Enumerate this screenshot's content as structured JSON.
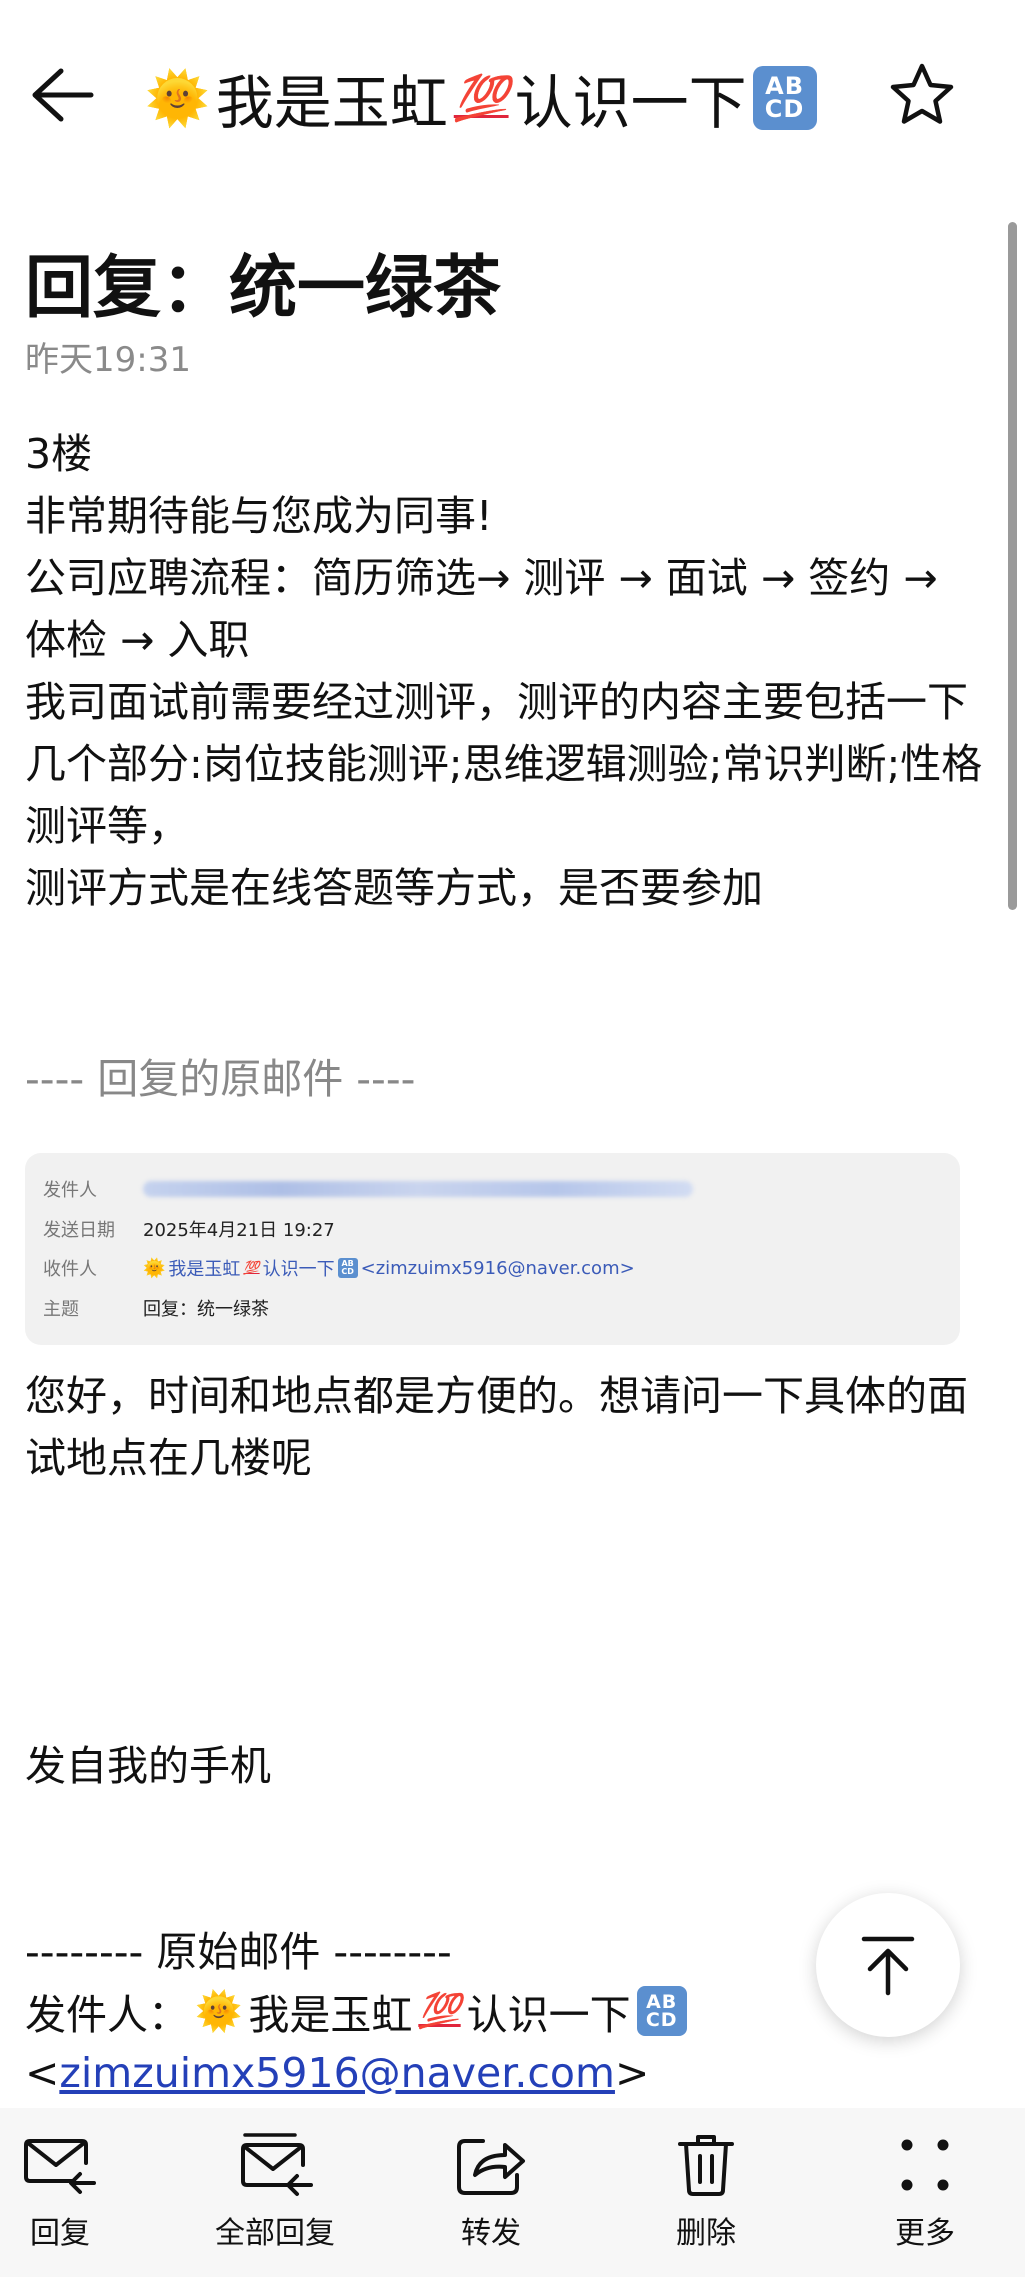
{
  "header": {
    "sender_display": {
      "sun": "🌞",
      "name_part1": "我是玉虹",
      "hundred": "💯",
      "name_part2": "认识一下",
      "abcd_top": "AB",
      "abcd_bottom": "CD"
    },
    "back_icon": "back-arrow-icon",
    "star_icon": "star-outline-icon"
  },
  "email": {
    "subject": "回复：统一绿茶",
    "time": "昨天19:31",
    "body_lines": [
      "3楼",
      "非常期待能与您成为同事!",
      "公司应聘流程：简历筛选→ 测评 → 面试 → 签约 → 体检 → 入职",
      "我司面试前需要经过测评，测评的内容主要包括一下几个部分:岗位技能测评;思维逻辑测验;常识判断;性格测评等，",
      "测评方式是在线答题等方式，是否要参加"
    ],
    "reply_divider": "---- 回复的原邮件 ----"
  },
  "quote": {
    "from_label": "发件人",
    "date_label": "发送日期",
    "date_value": "2025年4月21日 19:27",
    "to_label": "收件人",
    "to_email": "<zimzuimx5916@naver.com>",
    "subject_label": "主题",
    "subject_value": "回复：统一绿茶"
  },
  "reply": {
    "lines": [
      "您好，时间和地点都是方便的。想请问一下具体的面试地点在几楼呢"
    ],
    "signature": "发自我的手机"
  },
  "original": {
    "divider": "-------- 原始邮件 --------",
    "from_label": "发件人：",
    "email_open": "<",
    "email": "zimzuimx5916@naver.com",
    "email_close": ">"
  },
  "bottom_bar": {
    "reply": "回复",
    "reply_all": "全部回复",
    "forward": "转发",
    "delete": "删除",
    "more": "更多"
  }
}
